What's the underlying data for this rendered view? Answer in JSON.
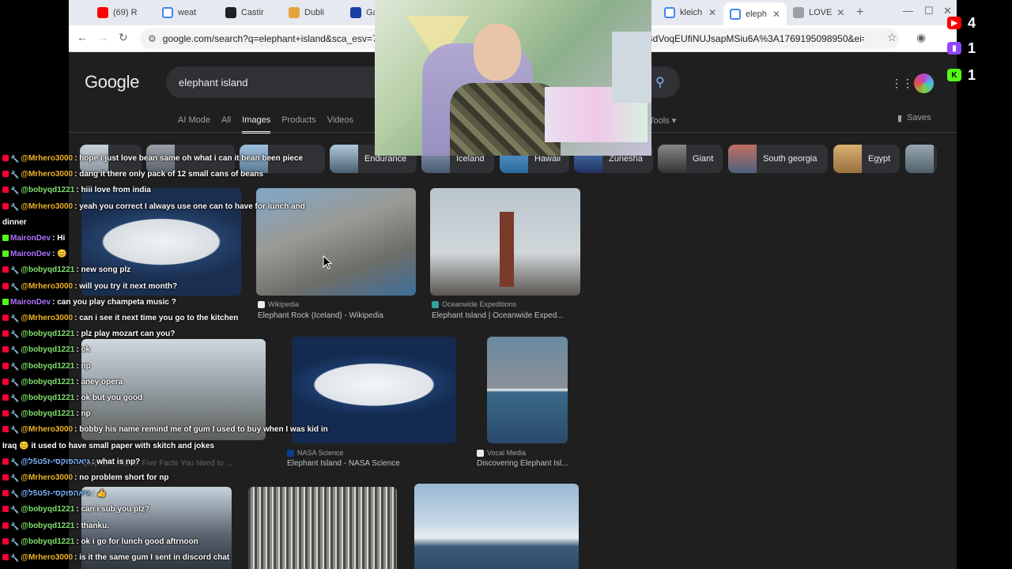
{
  "browser": {
    "tabs": [
      {
        "label": "(69) R",
        "favicon": "youtube-icon",
        "color": "#ff0000"
      },
      {
        "label": "weat",
        "favicon": "google-icon",
        "color": "#4285f4"
      },
      {
        "label": "Castir",
        "favicon": "castir-icon",
        "color": "#202124"
      },
      {
        "label": "Dubli",
        "favicon": "dublin-icon",
        "color": "#e6a23c"
      },
      {
        "label": "Ga",
        "favicon": "ga-icon",
        "color": "#1a3ea8"
      },
      {
        "label": "kleich",
        "favicon": "google-icon",
        "color": "#4285f4"
      },
      {
        "label": "eleph",
        "favicon": "google-icon",
        "color": "#4285f4"
      },
      {
        "label": "LOVE",
        "favicon": "cart-icon",
        "color": "#9aa0a6"
      }
    ],
    "url": "google.com/search?q=elephant+island&sca_esv=7615",
    "url_tail": "tSJZBdVoqEUfiNUJsapMSiu6A%3A1769195098950&ei=W..."
  },
  "google": {
    "logo": "Google",
    "query": "elephant island",
    "nav_tabs": [
      "AI Mode",
      "All",
      "Images",
      "Products",
      "Videos"
    ],
    "active_nav": "Images",
    "tools": "Tools",
    "saves": "Saves",
    "chips": [
      "Endurance",
      "Iceland",
      "Hawaii",
      "Zunesha",
      "Giant",
      "South georgia",
      "Egypt"
    ],
    "results": [
      {
        "source": "Wikipedia",
        "title": "Elephant Rock (Iceland) - Wikipedia"
      },
      {
        "source": "Oceanwide Expeditions",
        "title": "Elephant Island | Oceanwide Exped..."
      },
      {
        "source": "NASA Science",
        "title": "Elephant Island - NASA Science"
      },
      {
        "source": "Vocal Media",
        "title": "Discovering Elephant Isl..."
      }
    ],
    "hidden_caption": "Elephant Island: Five Facts You Need to ..."
  },
  "stream": {
    "counters": [
      {
        "platform": "youtube",
        "count": "4",
        "color": "#ff0000"
      },
      {
        "platform": "twitch",
        "count": "1",
        "color": "#9146ff"
      },
      {
        "platform": "kick",
        "count": "1",
        "color": "#53fc18"
      }
    ]
  },
  "chat": [
    {
      "platform": "yt",
      "user": "@Mrhero3000",
      "text": "hope i just love bean same oh what i can it bean been piece",
      "color": "orange"
    },
    {
      "platform": "yt",
      "user": "@Mrhero3000",
      "text": "dang it there only pack of 12 small cans of beans",
      "color": "orange"
    },
    {
      "platform": "yt",
      "user": "@bobyqd1221",
      "text": "hiii love from india",
      "color": "green"
    },
    {
      "platform": "yt",
      "user": "@Mrhero3000",
      "text": "yeah you correct I always use one can to have for lunch and",
      "color": "orange"
    },
    {
      "platform": "cont",
      "user": "",
      "text": "dinner",
      "color": "orange"
    },
    {
      "platform": "kick",
      "user": "MaironDev",
      "text": "Hi",
      "color": "purple"
    },
    {
      "platform": "kick",
      "user": "MaironDev",
      "text": "😊",
      "color": "purple"
    },
    {
      "platform": "yt",
      "user": "@bobyqd1221",
      "text": "new song plz",
      "color": "green"
    },
    {
      "platform": "yt",
      "user": "@Mrhero3000",
      "text": "will you try it next month?",
      "color": "orange"
    },
    {
      "platform": "kick",
      "user": "MaironDev",
      "text": "can you play champeta music ?",
      "color": "purple"
    },
    {
      "platform": "yt",
      "user": "@Mrhero3000",
      "text": "can i see it next time you go to the kitchen",
      "color": "orange"
    },
    {
      "platform": "yt",
      "user": "@bobyqd1221",
      "text": "plz play mozart can you?",
      "color": "green"
    },
    {
      "platform": "yt",
      "user": "@bobyqd1221",
      "text": "ok",
      "color": "green"
    },
    {
      "platform": "yt",
      "user": "@bobyqd1221",
      "text": "np",
      "color": "green"
    },
    {
      "platform": "yt",
      "user": "@bobyqd1221",
      "text": "aney opera",
      "color": "green"
    },
    {
      "platform": "yt",
      "user": "@bobyqd1221",
      "text": "ok but you good",
      "color": "green"
    },
    {
      "platform": "yt",
      "user": "@bobyqd1221",
      "text": "np",
      "color": "green"
    },
    {
      "platform": "yt",
      "user": "@Mrhero3000",
      "text": "bobby his name remind me of gum I used to buy when I was kid in",
      "color": "orange"
    },
    {
      "platform": "cont",
      "user": "",
      "text": "Iraq 😊 it used to have small paper with skitch and jokes",
      "color": "orange"
    },
    {
      "platform": "yt",
      "user": "@גיאהפוקסי-ז5ט5ל",
      "text": "what is np?",
      "color": "blue"
    },
    {
      "platform": "yt",
      "user": "@Mrhero3000",
      "text": "no problem short for np",
      "color": "orange"
    },
    {
      "platform": "yt",
      "user": "@גיאהפוקסי-ז5ט5ל",
      "text": "👍",
      "color": "blue"
    },
    {
      "platform": "yt",
      "user": "@bobyqd1221",
      "text": "can i sub you plz?",
      "color": "green"
    },
    {
      "platform": "yt",
      "user": "@bobyqd1221",
      "text": "thanku.",
      "color": "green"
    },
    {
      "platform": "yt",
      "user": "@bobyqd1221",
      "text": "ok i go for lunch good aftrnoon",
      "color": "green"
    },
    {
      "platform": "yt",
      "user": "@Mrhero3000",
      "text": "is it the same gum I sent in discord chat",
      "color": "orange"
    }
  ]
}
